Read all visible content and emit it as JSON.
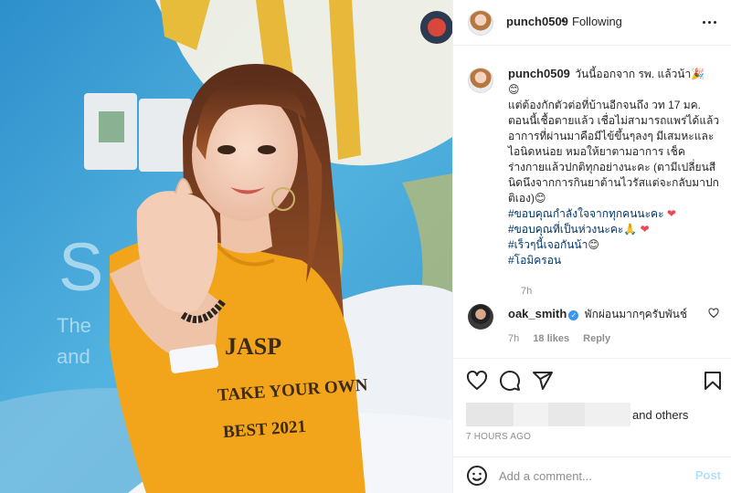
{
  "post": {
    "username": "punch0509",
    "follow_separator": "•",
    "follow_status": "Following",
    "photo_caption_text": [
      "JASP",
      "TAKE YOUR OWN",
      "BEST 2021"
    ],
    "background_letters": [
      "S",
      "The",
      "and"
    ]
  },
  "caption": {
    "username": "punch0509",
    "lines": [
      "วันนี้ออกจาก รพ. แล้วน้า🎉",
      "😊",
      "แต่ต้องกักตัวต่อที่บ้านอีกจนถึง วท 17 มค.",
      "ตอนนี้เชื้อตายแล้ว เชื่อไม่สามารถแพร่ได้แล้ว",
      "อาการที่ผ่านมาคือมีไข้ขึ้นๆลงๆ มีเสมหะและ",
      "ไอนิดหน่อย หมอให้ยาตามอาการ เช็ค",
      "ร่างกายแล้วปกติทุกอย่างนะคะ (ตามีเปลี่ยนสี",
      "นิดนึงจากการกินยาต้านไวรัสแต่จะกลับมาปก",
      "ติเอง)😊"
    ],
    "hashtags": [
      {
        "text": "#ขอบคุณกำลังใจจากทุกคนนะคะ",
        "emoji": " ❤"
      },
      {
        "text": "#ขอบคุณที่เป็นห่วงนะคะ",
        "emoji": "🙏 ❤"
      },
      {
        "text": "#เร็วๆนี้เจอกันน้า",
        "emoji": "😊"
      },
      {
        "text": "#โอมิครอน",
        "emoji": ""
      }
    ],
    "time": "7h"
  },
  "comment": {
    "username": "oak_smith",
    "verified_mark": "✓",
    "text": "พักผ่อนมากๆครับพันช์",
    "time": "7h",
    "likes": "18 likes",
    "reply": "Reply"
  },
  "actions": {
    "likes_suffix": "and others",
    "timestamp": "7 HOURS AGO"
  },
  "add_comment": {
    "placeholder": "Add a comment...",
    "post_label": "Post"
  },
  "icons": [
    "more-icon",
    "heart-icon",
    "comment-icon",
    "share-icon",
    "bookmark-icon",
    "emoji-icon",
    "verified-icon"
  ],
  "colors": {
    "link_blue": "#00376b",
    "post_button_disabled": "#b2dffc",
    "verified": "#3897f0",
    "heart_red": "#ed4956",
    "shirt_yellow": "#f2a51a"
  }
}
